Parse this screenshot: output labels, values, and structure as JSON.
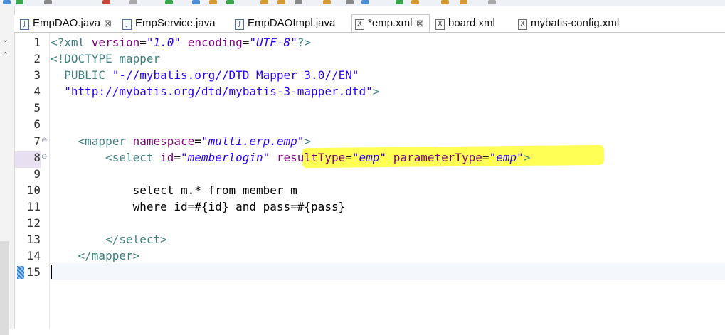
{
  "tabs": [
    {
      "label": "EmpDAO.java",
      "icon": "java-file-icon",
      "active": false,
      "closable": true
    },
    {
      "label": "EmpService.java",
      "icon": "java-file-icon",
      "active": false
    },
    {
      "label": "EmpDAOImpl.java",
      "icon": "java-file-icon",
      "active": false
    },
    {
      "label": "*emp.xml",
      "icon": "xml-file-icon",
      "active": true,
      "closable": true
    },
    {
      "label": "board.xml",
      "icon": "xml-file-icon",
      "active": false
    },
    {
      "label": "mybatis-config.xml",
      "icon": "xml-file-icon",
      "active": false
    }
  ],
  "close_glyph": "⊠",
  "editor": {
    "line_numbers": [
      "1",
      "2",
      "3",
      "4",
      "5",
      "6",
      "7",
      "8",
      "9",
      "10",
      "11",
      "12",
      "13",
      "14",
      "15"
    ],
    "lines": {
      "l1": {
        "a": "<?xml ",
        "b": "version",
        "c": "=",
        "d": "\"1.0\"",
        "e": " ",
        "f": "encoding",
        "g": "=",
        "h": "\"UTF-8\"",
        "i": "?>"
      },
      "l2": {
        "a": "<!DOCTYPE mapper"
      },
      "l3": {
        "a": "  PUBLIC ",
        "b": "\"-//mybatis.org//DTD Mapper 3.0//EN\""
      },
      "l4": {
        "a": "  ",
        "b": "\"http://mybatis.org/dtd/mybatis-3-mapper.dtd\"",
        "c": ">"
      },
      "l7": {
        "a": "    <mapper ",
        "b": "namespace",
        "c": "=",
        "d": "\"multi.erp.emp\"",
        "e": ">"
      },
      "l8": {
        "a": "        <select ",
        "b": "id",
        "c": "=",
        "d": "\"memberlogin\"",
        "e": " ",
        "f": "resultType",
        "g": "=",
        "h": "\"emp\"",
        "i": " ",
        "j": "parameterType",
        "k": "=",
        "l": "\"emp\"",
        "m": ">"
      },
      "l10": {
        "a": "            select m.* from member m"
      },
      "l11": {
        "a": "            where id=#{id} and pass=#{pass}"
      },
      "l13": {
        "a": "        </select>"
      },
      "l14": {
        "a": "    </mapper>"
      }
    }
  },
  "colors": {
    "highlight": "#ffff55",
    "tag": "#3f7f7f",
    "attribute": "#7f007f",
    "value": "#2a00ff"
  }
}
